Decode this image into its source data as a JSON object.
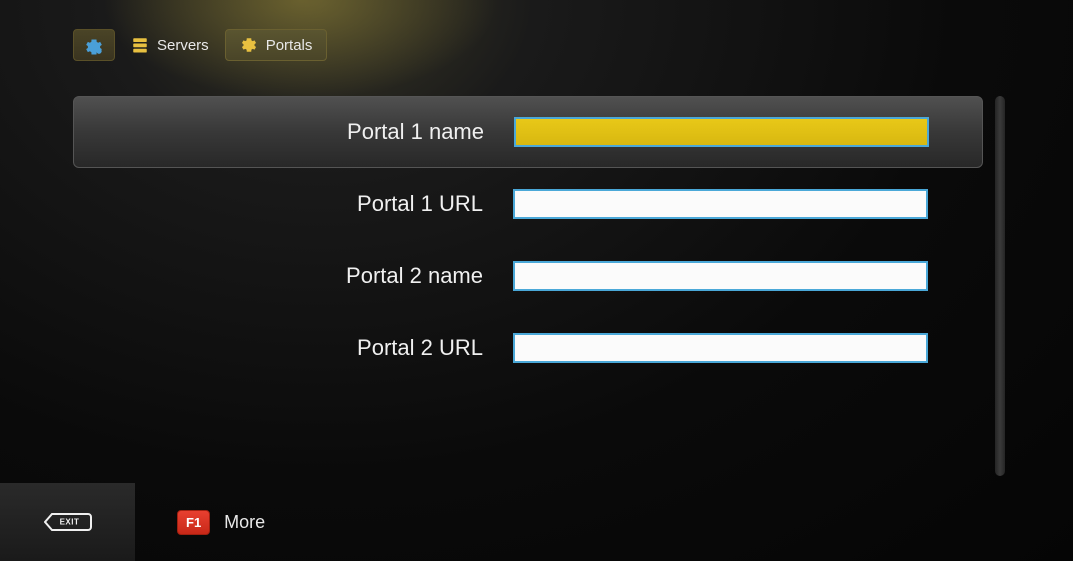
{
  "tabs": {
    "servers": "Servers",
    "portals": "Portals"
  },
  "form": {
    "fields": [
      {
        "label": "Portal 1 name",
        "value": "",
        "highlighted": true,
        "style": "yellow"
      },
      {
        "label": "Portal 1 URL",
        "value": "",
        "highlighted": false,
        "style": "white"
      },
      {
        "label": "Portal 2 name",
        "value": "",
        "highlighted": false,
        "style": "white"
      },
      {
        "label": "Portal 2 URL",
        "value": "",
        "highlighted": false,
        "style": "white"
      }
    ]
  },
  "bottom": {
    "exit": "EXIT",
    "f1_badge": "F1",
    "f1_label": "More"
  }
}
